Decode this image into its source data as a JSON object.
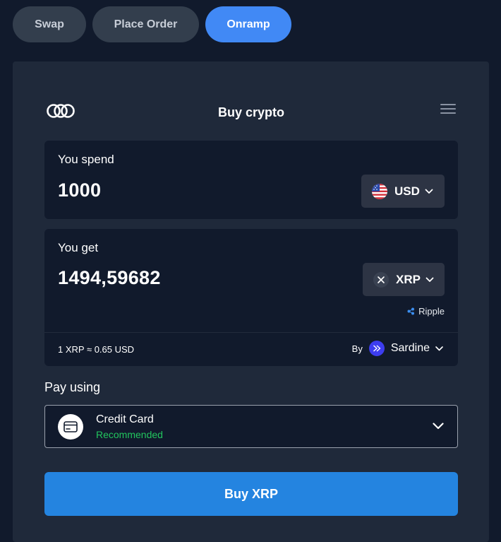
{
  "tabs": [
    {
      "label": "Swap",
      "active": false
    },
    {
      "label": "Place Order",
      "active": false
    },
    {
      "label": "Onramp",
      "active": true
    }
  ],
  "widget": {
    "title": "Buy crypto",
    "logo_icon": "rings-logo-icon",
    "menu_icon": "hamburger-menu-icon"
  },
  "spend": {
    "label": "You spend",
    "amount": "1000",
    "currency": "USD",
    "currency_icon": "us-flag-icon"
  },
  "get": {
    "label": "You get",
    "amount": "1494,59682",
    "currency": "XRP",
    "currency_icon": "xrp-icon",
    "network": "Ripple",
    "network_icon": "ripple-icon"
  },
  "quote": {
    "rate": "1 XRP ≈ 0.65 USD",
    "by_label": "By",
    "provider": "Sardine",
    "provider_icon": "sardine-logo-icon"
  },
  "payment": {
    "label": "Pay using",
    "method": "Credit Card",
    "tag": "Recommended",
    "method_icon": "credit-card-icon"
  },
  "buy_button": "Buy XRP",
  "colors": {
    "background": "#111a2c",
    "panel": "#1f293a",
    "accent": "#4189f5",
    "buy_button": "#2484e0",
    "recommended": "#22c55e"
  }
}
